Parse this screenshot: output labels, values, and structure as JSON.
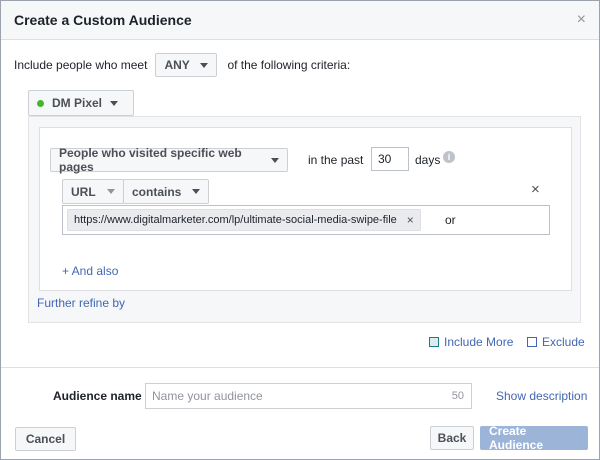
{
  "dialog": {
    "title": "Create a Custom Audience",
    "close_icon": "×"
  },
  "criteria": {
    "prefix": "Include people who meet",
    "match_value": "ANY",
    "suffix": "of the following criteria:"
  },
  "pixel": {
    "name": "DM Pixel",
    "status_color": "#42b72a"
  },
  "rule": {
    "traffic_type": "People who visited specific web pages",
    "in_the_past_label": "in the past",
    "days_value": "30",
    "days_label": "days",
    "info_icon": "i",
    "field": "URL",
    "operator": "contains",
    "remove_row_icon": "×",
    "url_token": "https://www.digitalmarketer.com/lp/ultimate-social-media-swipe-file",
    "token_remove_icon": "×",
    "url_entry_value": "or",
    "and_also": "+ And also"
  },
  "further_refine": "Further refine by",
  "actions": {
    "include_more": "Include More",
    "exclude": "Exclude"
  },
  "audience": {
    "label": "Audience name",
    "placeholder": "Name your audience",
    "char_remaining": "50",
    "show_description": "Show description"
  },
  "footer": {
    "cancel": "Cancel",
    "back": "Back",
    "create": "Create Audience"
  },
  "colors": {
    "link": "#4267b2",
    "create_disabled": "#9cb4d8"
  }
}
